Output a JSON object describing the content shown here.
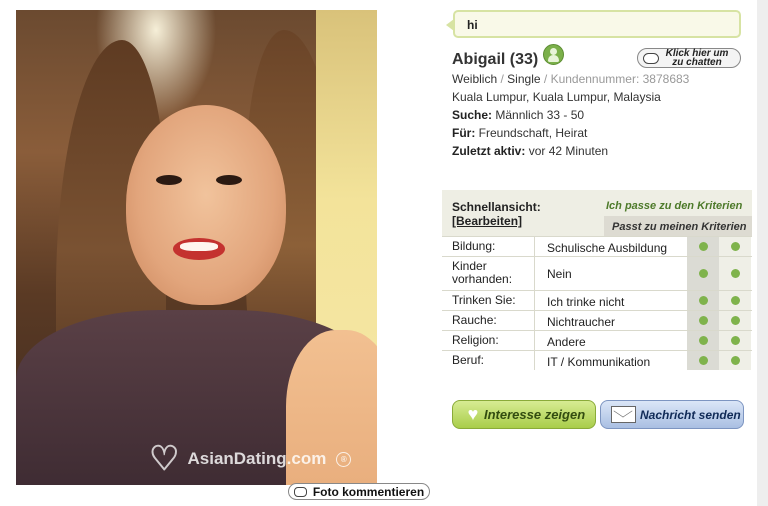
{
  "photo": {
    "watermark": "AsianDating.com",
    "watermark_mark": "®",
    "comment_button": "Foto kommentieren"
  },
  "profile": {
    "status_message": "hi",
    "name": "Abigail (33)",
    "gender": "Weiblich",
    "sep1": "/",
    "relationship": "Single",
    "sep2": "/",
    "customer_number_label": "Kundennummer:",
    "customer_number": "3878683",
    "location": "Kuala Lumpur, Kuala Lumpur, Malaysia",
    "seeking_label": "Suche:",
    "seeking": "Männlich 33 - 50",
    "for_label": "Für:",
    "for": "Freundschaft, Heirat",
    "last_active_label": "Zuletzt aktiv:",
    "last_active": "vor 42 Minuten",
    "chat_button": "Klick hier um zu chatten"
  },
  "quickview": {
    "title": "Schnellansicht:",
    "edit": "[Bearbeiten]",
    "tab_match_criteria": "Ich passe zu den Kriterien",
    "tab_matches_mine": "Passt zu meinen Kriterien",
    "rows": [
      {
        "label": "Bildung:",
        "value": "Schulische Ausbildung"
      },
      {
        "label": "Kinder vorhanden:",
        "value": "Nein"
      },
      {
        "label": "Trinken Sie:",
        "value": "Ich trinke nicht"
      },
      {
        "label": "Rauche:",
        "value": "Nichtraucher"
      },
      {
        "label": "Religion:",
        "value": "Andere"
      },
      {
        "label": "Beruf:",
        "value": "IT / Kommunikation"
      }
    ]
  },
  "actions": {
    "interest": "Interesse zeigen",
    "message": "Nachricht senden"
  },
  "colors": {
    "match_dot": "#7fb34c",
    "interest_button": "#a9cd4a",
    "message_button": "#a9bfe2"
  }
}
